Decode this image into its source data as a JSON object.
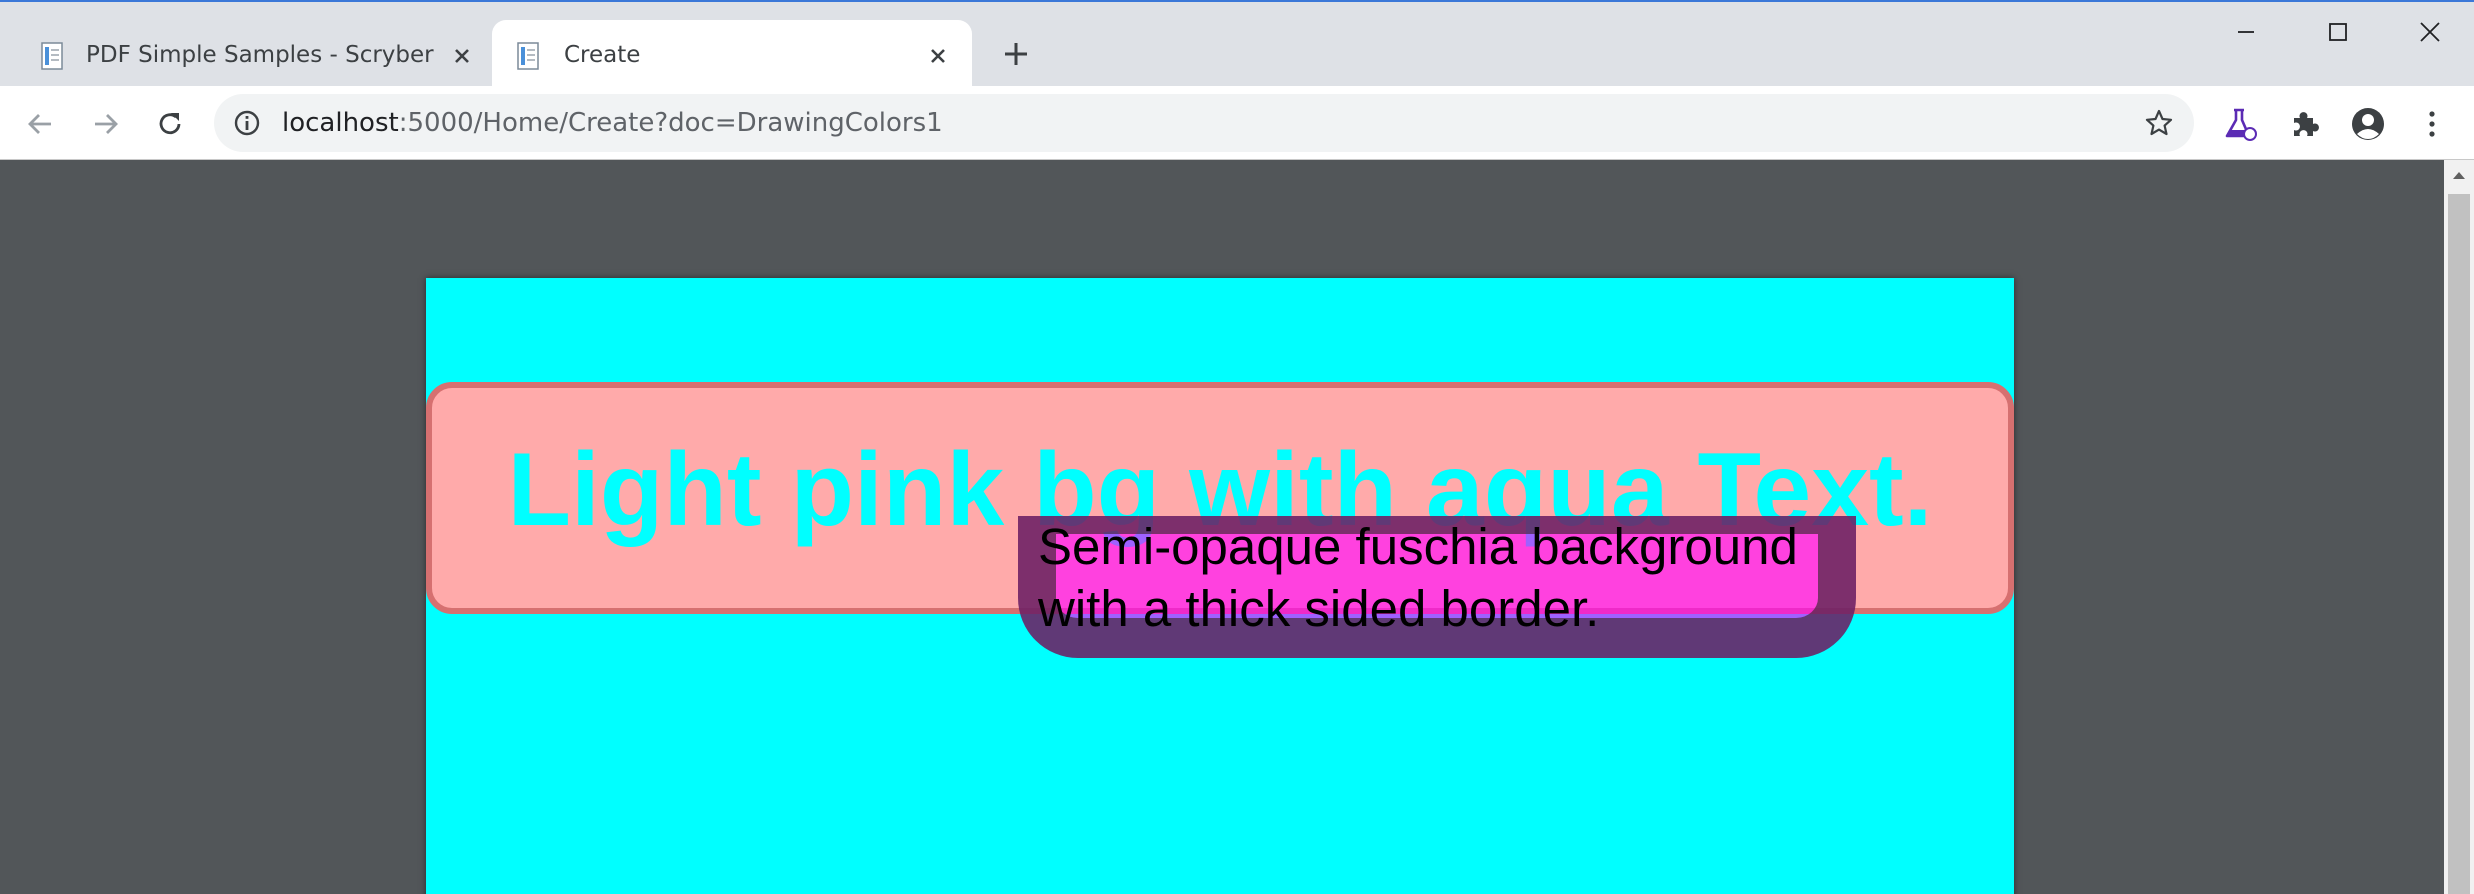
{
  "tabs": [
    {
      "title": "PDF Simple Samples - Scryber",
      "active": false,
      "icon": "document-icon"
    },
    {
      "title": "Create",
      "active": true,
      "icon": "document-icon"
    }
  ],
  "window_controls": [
    "minimize-icon",
    "maximize-icon",
    "close-icon"
  ],
  "toolbar": {
    "url_host": "localhost",
    "url_path": ":5000/Home/Create?doc=DrawingColors1",
    "buttons": [
      "back-icon",
      "forward-icon",
      "reload-icon",
      "info-icon",
      "star-icon",
      "flask-icon",
      "puzzle-icon",
      "account-icon",
      "menu-icon"
    ]
  },
  "document": {
    "heading": "Light pink bg with aqua Text.",
    "box_line1": "Semi-opaque fuschia background",
    "box_line2": "with a thick sided border."
  },
  "colors": {
    "page_background": "#00ffff",
    "pink_background": "#ffaaaa",
    "heading_text": "#00ffff",
    "fuschia_background": "#ff00ff",
    "viewer_background": "#525659"
  }
}
